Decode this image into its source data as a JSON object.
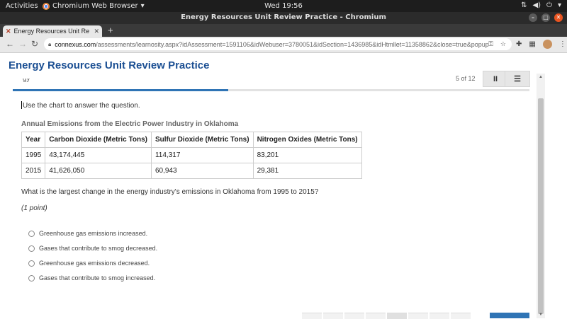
{
  "system_bar": {
    "activities": "Activities",
    "app_menu": "Chromium Web Browser",
    "clock": "Wed 19:56"
  },
  "window": {
    "title": "Energy Resources Unit Review Practice - Chromium"
  },
  "tab": {
    "label": "Energy Resources Unit Re",
    "new_tab": "+"
  },
  "address_bar": {
    "host": "connexus.com",
    "path": "/assessments/learnosity.aspx?idAssessment=1591106&idWebuser=3780051&idSection=1436985&idHtmllet=11358862&close=true&popup=true"
  },
  "page": {
    "title": "Energy Resources Unit Review Practice",
    "counter": "5 of 12",
    "progress_fraction": 0.417,
    "instruction": "Use the chart to answer the question.",
    "table_title": "Annual Emissions from the Electric Power Industry in Oklahoma",
    "table": {
      "headers": [
        "Year",
        "Carbon Dioxide (Metric Tons)",
        "Sulfur Dioxide (Metric Tons)",
        "Nitrogen Oxides (Metric Tons)"
      ],
      "rows": [
        [
          "1995",
          "43,174,445",
          "114,317",
          "83,201"
        ],
        [
          "2015",
          "41,626,050",
          "60,943",
          "29,381"
        ]
      ]
    },
    "question": "What is the largest change in the energy industry's emissions in Oklahoma from 1995 to 2015?",
    "points": "(1 point)",
    "options": [
      "Greenhouse gas emissions increased.",
      "Gases that contribute to smog decreased.",
      "Greenhouse gas emissions decreased.",
      "Gases that contribute to smog increased."
    ]
  }
}
